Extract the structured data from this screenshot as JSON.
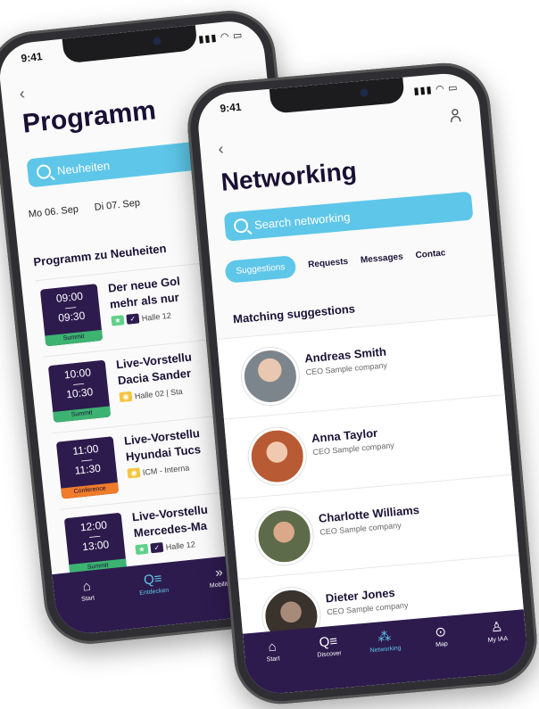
{
  "back_phone": {
    "time": "9:41",
    "title": "Programm",
    "search_placeholder": "Neuheiten",
    "days": [
      "Mo 06. Sep",
      "Di 07. Sep"
    ],
    "section_title": "Programm zu Neuheiten",
    "items": [
      {
        "start": "09:00",
        "end": "09:30",
        "badge": "Summit",
        "badge_color": "#3cb371",
        "line1": "Der neue Gol",
        "line2": "mehr als nur",
        "meta": "Halle 12"
      },
      {
        "start": "10:00",
        "end": "10:30",
        "badge": "Summit",
        "badge_color": "#3cb371",
        "line1": "Live-Vorstellu",
        "line2": "Dacia Sander",
        "meta": "Halle 02 | Sta"
      },
      {
        "start": "11:00",
        "end": "11:30",
        "badge": "Conference",
        "badge_color": "#f07b2a",
        "line1": "Live-Vorstellu",
        "line2": "Hyundai Tucs",
        "meta": "ICM - Interna"
      },
      {
        "start": "12:00",
        "end": "13:00",
        "badge": "Summit",
        "badge_color": "#3cb371",
        "line1": "Live-Vorstellu",
        "line2": "Mercedes-Ma",
        "meta": "Halle 12"
      }
    ],
    "tabs": [
      {
        "label": "Start",
        "icon": "home-icon"
      },
      {
        "label": "Entdecken",
        "icon": "discover-icon"
      },
      {
        "label": "Mobility",
        "icon": "mobility-icon"
      }
    ]
  },
  "front_phone": {
    "time": "9:41",
    "title": "Networking",
    "search_placeholder": "Search networking",
    "filter_tabs": [
      "Suggestions",
      "Requests",
      "Messages",
      "Contac"
    ],
    "section_title": "Matching suggestions",
    "people": [
      {
        "name": "Andreas Smith",
        "role": "CEO Sample company",
        "avatar_color": "#8a8f94"
      },
      {
        "name": "Anna  Taylor",
        "role": "CEO Sample company",
        "avatar_color": "#c4704a"
      },
      {
        "name": "Charlotte Williams",
        "role": "CEO Sample company",
        "avatar_color": "#6f7d58"
      },
      {
        "name": "Dieter Jones",
        "role": "CEO Sample company",
        "avatar_color": "#4a4039"
      }
    ],
    "tabs": [
      {
        "label": "Start",
        "icon": "home-icon"
      },
      {
        "label": "Discover",
        "icon": "discover-icon"
      },
      {
        "label": "Networking",
        "icon": "networking-icon"
      },
      {
        "label": "Map",
        "icon": "map-pin-icon"
      },
      {
        "label": "My IAA",
        "icon": "profile-icon"
      }
    ]
  },
  "colors": {
    "brand_purple": "#2d1b4e",
    "accent_blue": "#5ec6e8"
  }
}
